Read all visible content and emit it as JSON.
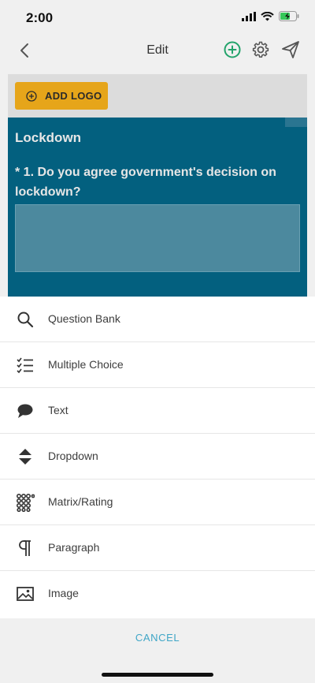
{
  "status": {
    "time": "2:00"
  },
  "nav": {
    "title": "Edit"
  },
  "accent_colors": {
    "add_icon": "#23a36b",
    "logo_button": "#e6a51a",
    "survey_background": "#03607f",
    "cancel_text": "#3fa6c7"
  },
  "survey": {
    "logo_button_label": "ADD LOGO",
    "title": "Lockdown",
    "question": "* 1. Do you agree government's decision on lockdown?"
  },
  "menu": {
    "items": [
      {
        "label": "Question Bank",
        "icon": "search-icon"
      },
      {
        "label": "Multiple Choice",
        "icon": "checklist-icon"
      },
      {
        "label": "Text",
        "icon": "speech-bubble-icon"
      },
      {
        "label": "Dropdown",
        "icon": "up-down-arrows-icon"
      },
      {
        "label": "Matrix/Rating",
        "icon": "grid-dots-icon"
      },
      {
        "label": "Paragraph",
        "icon": "pilcrow-icon"
      },
      {
        "label": "Image",
        "icon": "image-icon"
      }
    ],
    "cancel_label": "CANCEL"
  }
}
